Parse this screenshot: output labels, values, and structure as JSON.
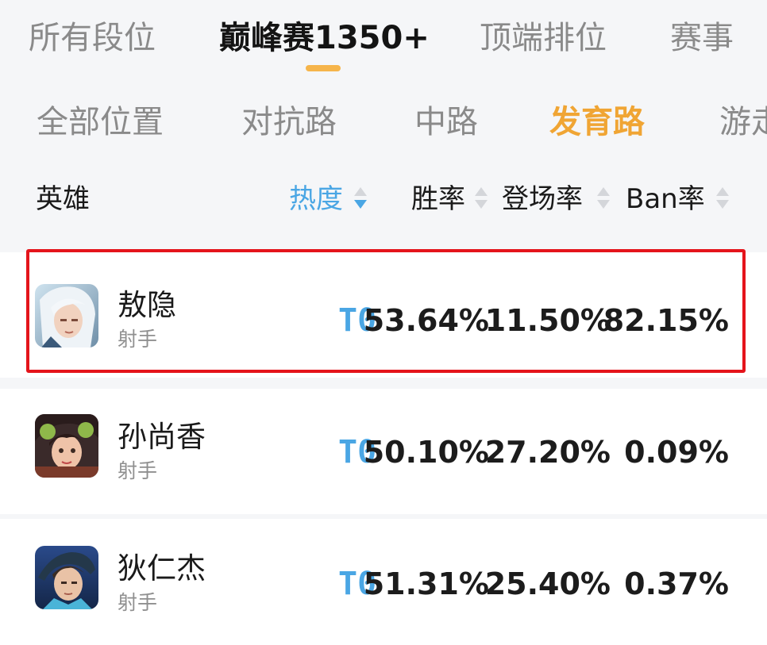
{
  "tier_tabs": [
    "所有段位",
    "巅峰赛1350+",
    "顶端排位",
    "赛事"
  ],
  "active_tier_tab": "巅峰赛1350+",
  "position_tabs": [
    "全部位置",
    "对抗路",
    "中路",
    "发育路",
    "游走"
  ],
  "active_position_tab": "发育路",
  "columns": {
    "hero": "英雄",
    "heat": "热度",
    "win_rate": "胜率",
    "pick_rate": "登场率",
    "ban_rate": "Ban率"
  },
  "sorted_by": "热度",
  "heroes": [
    {
      "name": "敖隐",
      "role": "射手",
      "tier": "T0",
      "win_rate": "53.64%",
      "pick_rate": "11.50%",
      "ban_rate": "82.15%",
      "highlighted": true
    },
    {
      "name": "孙尚香",
      "role": "射手",
      "tier": "T0",
      "win_rate": "50.10%",
      "pick_rate": "27.20%",
      "ban_rate": "0.09%",
      "highlighted": false
    },
    {
      "name": "狄仁杰",
      "role": "射手",
      "tier": "T0",
      "win_rate": "51.31%",
      "pick_rate": "25.40%",
      "ban_rate": "0.37%",
      "highlighted": false
    }
  ],
  "colors": {
    "accent_blue": "#4aa6e4",
    "accent_orange": "#f0a534",
    "highlight_red": "#e4141b"
  }
}
